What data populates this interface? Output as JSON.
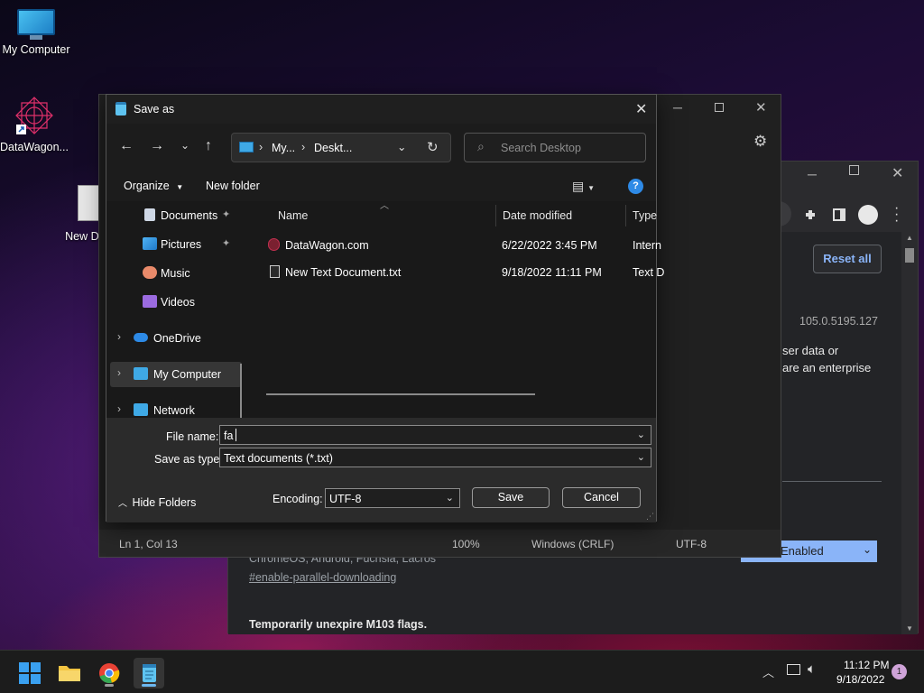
{
  "desktop": {
    "icons": [
      {
        "label": "My Computer"
      },
      {
        "label": "DataWagon..."
      },
      {
        "label": "New Docu"
      }
    ]
  },
  "chrome": {
    "reset_all": "Reset all",
    "version": "105.0.5195.127",
    "snippet_1": "ser data or",
    "snippet_2": "are an enterprise",
    "platforms": "ChromeOS, Android, Fuchsia, Lacros",
    "flag_link": "#enable-parallel-downloading",
    "select_value": "Enabled",
    "heading": "Temporarily unexpire M103 flags."
  },
  "notepad": {
    "status": {
      "position": "Ln 1, Col 13",
      "zoom": "100%",
      "line_ending": "Windows (CRLF)",
      "encoding": "UTF-8"
    }
  },
  "dialog": {
    "title": "Save as",
    "breadcrumb": [
      "My...",
      "Deskt..."
    ],
    "search_placeholder": "Search Desktop",
    "organize": "Organize",
    "new_folder": "New folder",
    "nav_items": [
      {
        "label": "Documents",
        "icon": "documents-icon"
      },
      {
        "label": "Pictures",
        "icon": "pictures-icon"
      },
      {
        "label": "Music",
        "icon": "music-icon"
      },
      {
        "label": "Videos",
        "icon": "videos-icon"
      },
      {
        "label": "OneDrive",
        "icon": "onedrive-icon"
      },
      {
        "label": "My Computer",
        "icon": "computer-icon"
      },
      {
        "label": "Network",
        "icon": "network-icon"
      }
    ],
    "columns": {
      "name": "Name",
      "date": "Date modified",
      "type": "Type"
    },
    "files": [
      {
        "name": "DataWagon.com",
        "date": "6/22/2022 3:45 PM",
        "type": "Intern"
      },
      {
        "name": "New Text Document.txt",
        "date": "9/18/2022 11:11 PM",
        "type": "Text D"
      }
    ],
    "file_name_label": "File name:",
    "file_name_value": "fa",
    "save_type_label": "Save as type:",
    "save_type_value": "Text documents (*.txt)",
    "hide_folders": "Hide Folders",
    "encoding_label": "Encoding:",
    "encoding_value": "UTF-8",
    "save": "Save",
    "cancel": "Cancel"
  },
  "taskbar": {
    "time": "11:12 PM",
    "date": "9/18/2022",
    "notification_count": "1"
  }
}
